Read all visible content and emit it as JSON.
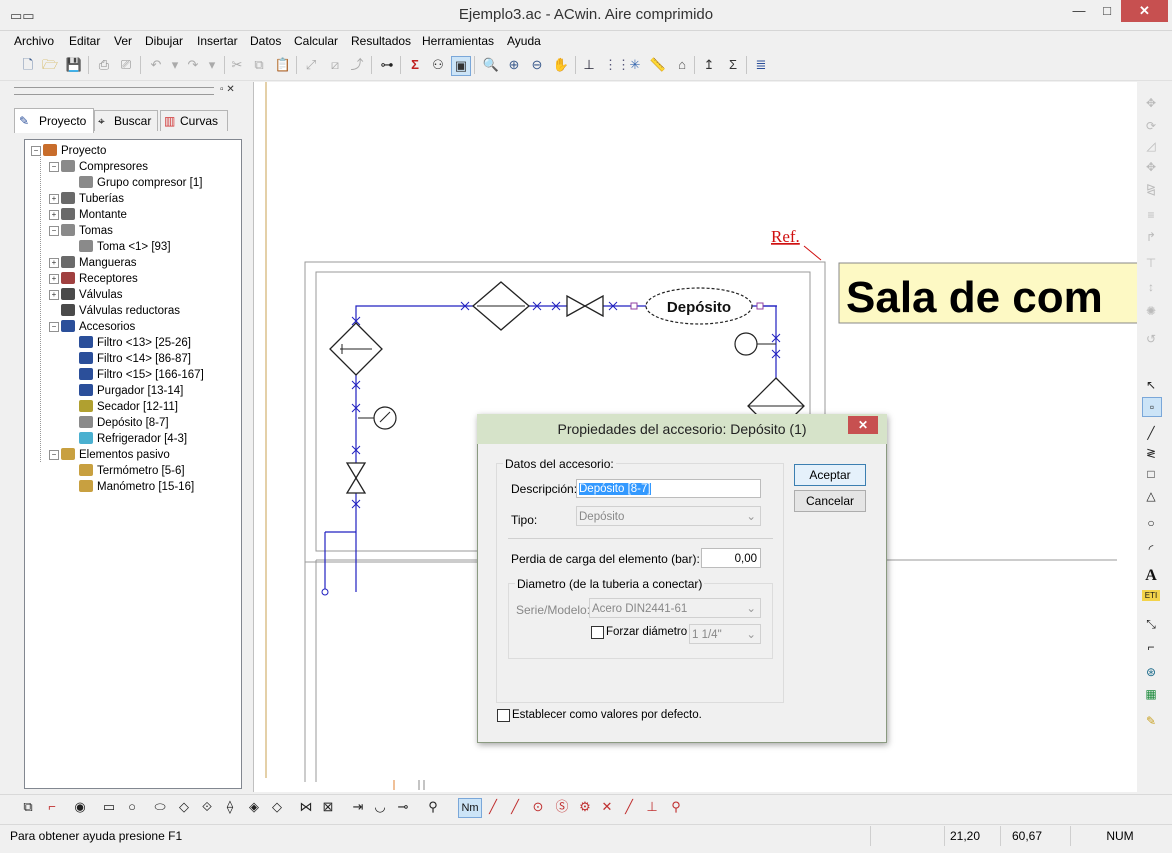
{
  "window": {
    "title": "Ejemplo3.ac - ACwin. Aire comprimido",
    "minimize": "—",
    "maximize": "□",
    "close": "✕"
  },
  "menu": [
    "Archivo",
    "Editar",
    "Ver",
    "Dibujar",
    "Insertar",
    "Datos",
    "Calcular",
    "Resultados",
    "Herramientas",
    "Ayuda"
  ],
  "panel": {
    "tabs": {
      "proyecto": "Proyecto",
      "buscar": "Buscar",
      "curvas": "Curvas"
    },
    "controls": "▫ ✕"
  },
  "tree": [
    {
      "label": "Proyecto",
      "exp": "−",
      "color": "#c86d2b"
    },
    {
      "label": "Compresores",
      "exp": "−",
      "color": "#8a8a8a"
    },
    {
      "label": "Grupo compresor [1]",
      "exp": "",
      "color": "#8a8a8a"
    },
    {
      "label": "Tuberías",
      "exp": "+",
      "color": "#6a6a6a"
    },
    {
      "label": "Montante",
      "exp": "+",
      "color": "#6a6a6a"
    },
    {
      "label": "Tomas",
      "exp": "−",
      "color": "#8a8a8a"
    },
    {
      "label": "Toma <1> [93]",
      "exp": "",
      "color": "#8a8a8a"
    },
    {
      "label": "Mangueras",
      "exp": "+",
      "color": "#6a6a6a"
    },
    {
      "label": "Receptores",
      "exp": "+",
      "color": "#a04040"
    },
    {
      "label": "Válvulas",
      "exp": "+",
      "color": "#4a4a4a"
    },
    {
      "label": "Válvulas reductoras",
      "exp": "",
      "color": "#4a4a4a"
    },
    {
      "label": "Accesorios",
      "exp": "−",
      "color": "#2b4f9a"
    },
    {
      "label": "Filtro <13> [25-26]",
      "exp": "",
      "color": "#2b4f9a"
    },
    {
      "label": "Filtro <14> [86-87]",
      "exp": "",
      "color": "#2b4f9a"
    },
    {
      "label": "Filtro <15> [166-167]",
      "exp": "",
      "color": "#2b4f9a"
    },
    {
      "label": "Purgador [13-14]",
      "exp": "",
      "color": "#2b4f9a"
    },
    {
      "label": "Secador [12-11]",
      "exp": "",
      "color": "#b0a030"
    },
    {
      "label": "Depósito [8-7]",
      "exp": "",
      "color": "#8a8a8a"
    },
    {
      "label": "Refrigerador [4-3]",
      "exp": "",
      "color": "#4ab0d0"
    },
    {
      "label": "Elementos pasivo",
      "exp": "−",
      "color": "#c8a040"
    },
    {
      "label": "Termómetro [5-6]",
      "exp": "",
      "color": "#c8a040"
    },
    {
      "label": "Manómetro [15-16]",
      "exp": "",
      "color": "#c8a040"
    }
  ],
  "drawing": {
    "ref_label": "Ref.",
    "room_label": "Sala de com",
    "deposit_label": "Depósito"
  },
  "dialog": {
    "title": "Propiedades del accesorio: Depósito (1)",
    "close": "✕",
    "accept": "Aceptar",
    "cancel": "Cancelar",
    "group_label": "Datos del accesorio:",
    "description_label": "Descripción:",
    "description_value": "Depósito [8-7]",
    "type_label": "Tipo:",
    "type_value": "Depósito",
    "pressure_loss_label": "Perdia de carga del elemento (bar):",
    "pressure_loss_value": "0,00",
    "diameter_group_label": "Diametro (de la tuberia a conectar)",
    "series_label": "Serie/Modelo:",
    "series_value": "Acero DIN2441-61",
    "force_diameter_label": "Forzar diámetro",
    "force_diameter_value": "1 1/4\"",
    "default_label": "Establecer como valores por defecto."
  },
  "status": {
    "help": "Para obtener ayuda presione F1",
    "x": "21,20",
    "y": "60,67",
    "num": "NUM"
  },
  "bottom_toolbar": {
    "nm_label": "Nm"
  }
}
